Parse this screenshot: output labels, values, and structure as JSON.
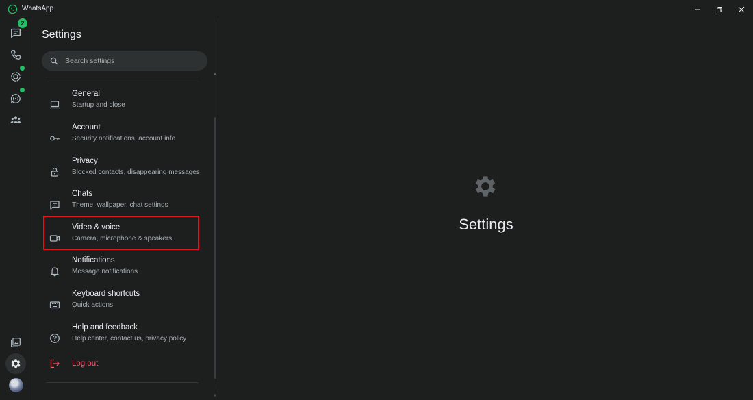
{
  "app": {
    "title": "WhatsApp"
  },
  "rail": {
    "chats_badge": "2"
  },
  "settings": {
    "title": "Settings",
    "search_placeholder": "Search settings",
    "items": [
      {
        "label": "General",
        "sub": "Startup and close",
        "icon": "laptop-icon"
      },
      {
        "label": "Account",
        "sub": "Security notifications, account info",
        "icon": "key-icon"
      },
      {
        "label": "Privacy",
        "sub": "Blocked contacts, disappearing messages",
        "icon": "lock-icon"
      },
      {
        "label": "Chats",
        "sub": "Theme, wallpaper, chat settings",
        "icon": "chat-icon"
      },
      {
        "label": "Video & voice",
        "sub": "Camera, microphone & speakers",
        "icon": "video-icon"
      },
      {
        "label": "Notifications",
        "sub": "Message notifications",
        "icon": "bell-icon"
      },
      {
        "label": "Keyboard shortcuts",
        "sub": "Quick actions",
        "icon": "keyboard-icon"
      },
      {
        "label": "Help and feedback",
        "sub": "Help center, contact us, privacy policy",
        "icon": "help-icon"
      }
    ],
    "logout_label": "Log out"
  },
  "main": {
    "title": "Settings"
  },
  "colors": {
    "accent": "#21c063",
    "logout": "#f15c6d",
    "highlight": "#e0161a",
    "background": "#1d1f1f"
  }
}
